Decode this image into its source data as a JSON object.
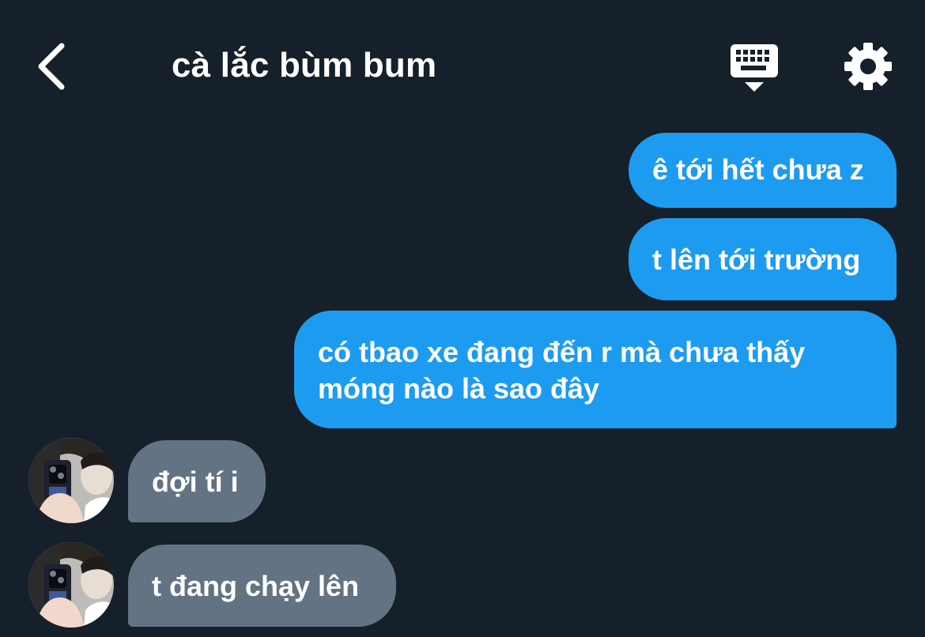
{
  "header": {
    "title": "cà lắc bùm bum",
    "back_icon": "chevron-left-icon",
    "keyboard_icon": "keyboard-icon",
    "settings_icon": "gear-icon"
  },
  "colors": {
    "background": "#16202a",
    "sent_bubble": "#1d9bf0",
    "received_bubble": "#637384",
    "text": "#ffffff"
  },
  "messages": [
    {
      "from": "me",
      "text": "ê tới hết chưa z"
    },
    {
      "from": "me",
      "text": "t lên tới trường"
    },
    {
      "from": "me",
      "text": "có tbao xe đang đến r mà chưa thấy móng nào là sao đây"
    },
    {
      "from": "other",
      "text": "đợi tí i"
    },
    {
      "from": "other",
      "text": "t đang chạy lên"
    }
  ]
}
